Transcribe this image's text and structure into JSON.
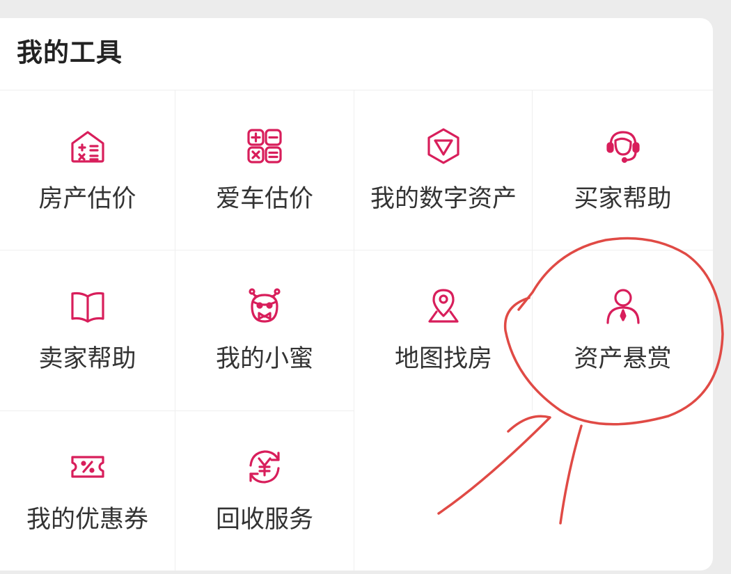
{
  "card": {
    "title": "我的工具"
  },
  "tools": [
    {
      "label": "房产估价",
      "icon": "house-calculator-icon"
    },
    {
      "label": "爱车估价",
      "icon": "calculator-grid-icon"
    },
    {
      "label": "我的数字资产",
      "icon": "digital-asset-hexagon-icon"
    },
    {
      "label": "买家帮助",
      "icon": "headset-agent-icon"
    },
    {
      "label": "卖家帮助",
      "icon": "open-book-icon"
    },
    {
      "label": "我的小蜜",
      "icon": "owl-assistant-icon"
    },
    {
      "label": "地图找房",
      "icon": "map-pin-icon"
    },
    {
      "label": "资产悬赏",
      "icon": "person-tie-icon"
    },
    {
      "label": "我的优惠券",
      "icon": "coupon-percent-icon"
    },
    {
      "label": "回收服务",
      "icon": "yen-recycle-icon"
    }
  ],
  "colors": {
    "accent": "#d81e5b",
    "annotation": "#e04a45"
  }
}
